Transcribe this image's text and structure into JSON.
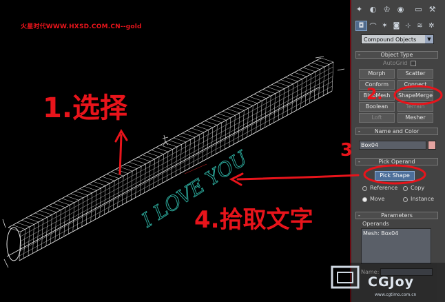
{
  "watermark": "火星时代WWW.HXSD.COM.CN--gold",
  "annotations": {
    "step1": "1.选择",
    "step2": "2.",
    "step3": "3",
    "step4": "4.拾取文字",
    "viewport_text": "I LOVE YOU"
  },
  "toolbar": {
    "tabs": [
      {
        "name": "create-icon",
        "glyph": "✦"
      },
      {
        "name": "modify-icon",
        "glyph": "◐"
      },
      {
        "name": "hierarchy-icon",
        "glyph": "♔"
      },
      {
        "name": "motion-icon",
        "glyph": "◉"
      },
      {
        "name": "display-icon",
        "glyph": "▭"
      },
      {
        "name": "utilities-icon",
        "glyph": "⚒"
      }
    ],
    "subtabs": [
      {
        "name": "geometry-icon",
        "glyph": "◘"
      },
      {
        "name": "shapes-icon",
        "glyph": "⌒"
      },
      {
        "name": "lights-icon",
        "glyph": "✶"
      },
      {
        "name": "cameras-icon",
        "glyph": "◙"
      },
      {
        "name": "helpers-icon",
        "glyph": "⊹"
      },
      {
        "name": "spacewarps-icon",
        "glyph": "≋"
      },
      {
        "name": "systems-icon",
        "glyph": "✲"
      }
    ]
  },
  "category_dropdown": {
    "value": "Compound Objects"
  },
  "object_type": {
    "title": "Object Type",
    "autogrid_label": "AutoGrid",
    "buttons": [
      {
        "label": "Morph",
        "enabled": true
      },
      {
        "label": "Scatter",
        "enabled": true
      },
      {
        "label": "Conform",
        "enabled": true
      },
      {
        "label": "Connect",
        "enabled": true
      },
      {
        "label": "BlobMesh",
        "enabled": true
      },
      {
        "label": "ShapeMerge",
        "enabled": true
      },
      {
        "label": "Boolean",
        "enabled": true
      },
      {
        "label": "Terrain",
        "enabled": false
      },
      {
        "label": "Loft",
        "enabled": false
      },
      {
        "label": "Mesher",
        "enabled": true
      }
    ]
  },
  "name_and_color": {
    "title": "Name and Color",
    "name_value": "Box04",
    "color": "#e3a3a0"
  },
  "pick_operand": {
    "title": "Pick Operand",
    "pick_button": "Pick Shape",
    "options": [
      {
        "label": "Reference",
        "checked": false
      },
      {
        "label": "Copy",
        "checked": false
      },
      {
        "label": "Move",
        "checked": true
      },
      {
        "label": "Instance",
        "checked": false
      }
    ]
  },
  "parameters": {
    "title": "Parameters",
    "operands_label": "Operands",
    "operands": [
      "Mesh: Box04"
    ],
    "name_label": "Name:"
  },
  "logo": {
    "text": "CGJoy",
    "sub": "www.cgtimo.com.cn"
  },
  "colors": {
    "annotation": "#e8141b",
    "viewport_text": "#2fb5a6",
    "wire": "#e6e6e6",
    "panel": "#434343"
  }
}
